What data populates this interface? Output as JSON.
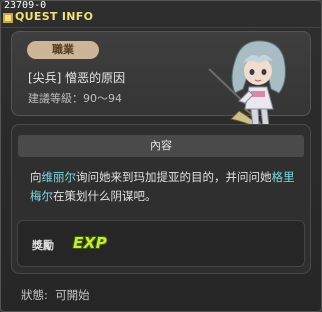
{
  "window": {
    "quest_id": "23709-0",
    "title": "QUEST INFO",
    "accent_color": "#f0e07a"
  },
  "job_panel": {
    "tag": "職業",
    "quest_name": "[尖兵] 憎恶的原因",
    "level_label": "建議等級",
    "level_range": "90～94"
  },
  "content": {
    "header": "內容",
    "description_parts": [
      {
        "text": "向",
        "highlight": false
      },
      {
        "text": "维丽尔",
        "highlight": true
      },
      {
        "text": "询问她来到玛加提亚的目的，并问问她",
        "highlight": false
      },
      {
        "text": "格里梅尔",
        "highlight": true
      },
      {
        "text": "在策划什么阴谋吧。",
        "highlight": false
      }
    ],
    "highlight_color": "#7fd6e3"
  },
  "reward": {
    "label": "獎勵",
    "exp_icon": "exp-icon",
    "exp_text": "EXP"
  },
  "status": {
    "label": "狀態",
    "value": "可開始"
  }
}
